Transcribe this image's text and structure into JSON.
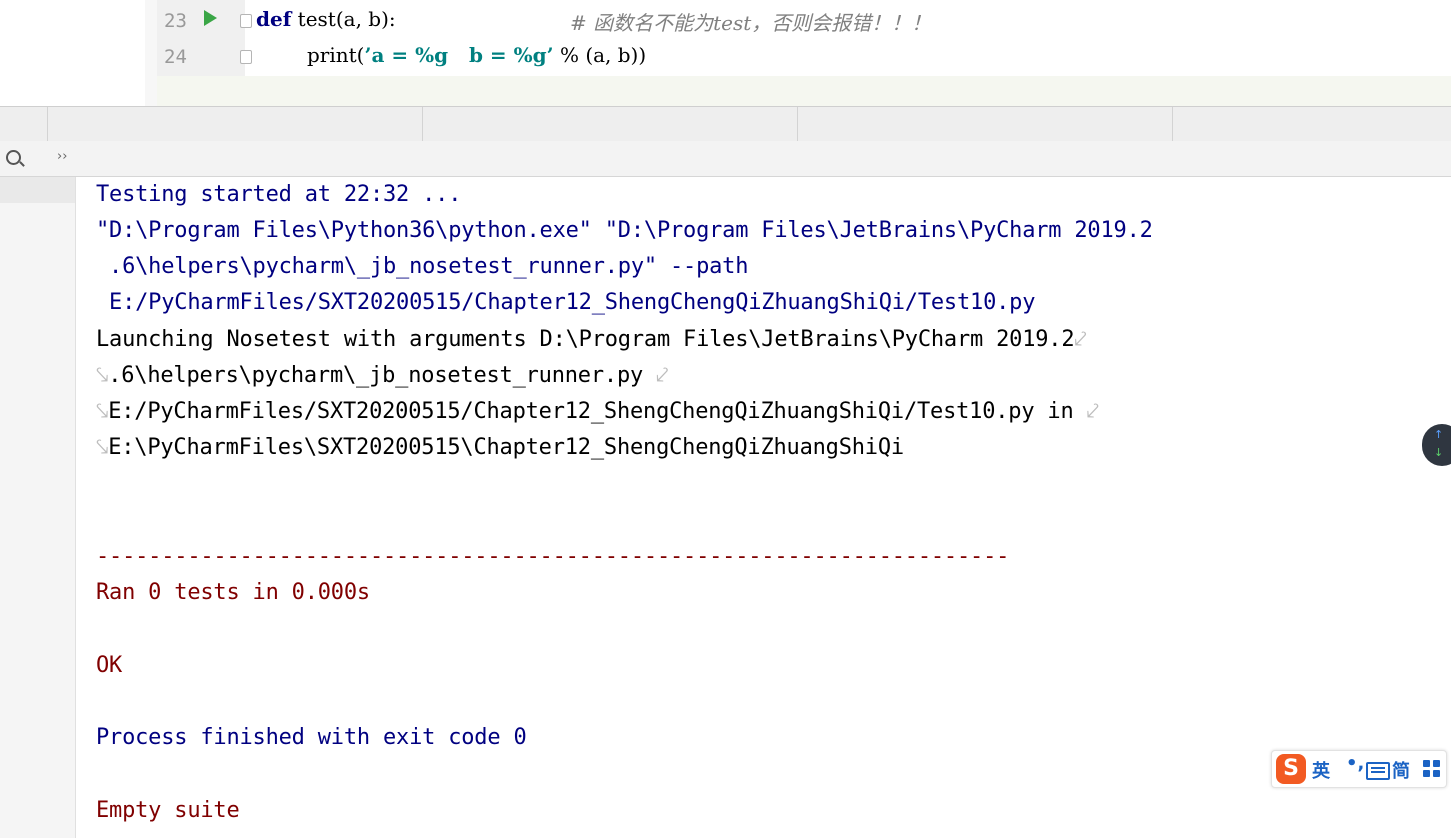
{
  "editor": {
    "line_numbers": [
      "23",
      "24"
    ],
    "line23": {
      "keyword": "def",
      "rest": " test(a, b):",
      "comment": "# 函数名不能为test，否则会报错！！！"
    },
    "line24": {
      "func": "print(",
      "string": "’a = %g   b = %g’",
      "rest": " % (a, b))"
    }
  },
  "toolbar": {
    "more_label": "››"
  },
  "console": {
    "lines": [
      "Testing started at 22:32 ...",
      "\"D:\\Program Files\\Python36\\python.exe\" \"D:\\Program Files\\JetBrains\\PyCharm 2019.2",
      " .6\\helpers\\pycharm\\_jb_nosetest_runner.py\" --path",
      " E:/PyCharmFiles/SXT20200515/Chapter12_ShengChengQiZhuangShiQi/Test10.py",
      "Launching Nosetest with arguments D:\\Program Files\\JetBrains\\PyCharm 2019.2",
      ".6\\helpers\\pycharm\\_jb_nosetest_runner.py ",
      "E:/PyCharmFiles/SXT20200515/Chapter12_ShengChengQiZhuangShiQi/Test10.py in ",
      "E:\\PyCharmFiles\\SXT20200515\\Chapter12_ShengChengQiZhuangShiQi",
      "----------------------------------------------------------------------",
      "Ran 0 tests in 0.000s",
      "OK",
      "Process finished with exit code 0",
      "Empty suite"
    ],
    "wrap_glyph_end": "⤦",
    "wrap_glyph_start": "⤥"
  },
  "ime": {
    "logo": "S",
    "lang": "英",
    "punct": "•,",
    "mode": "简"
  },
  "nav": {
    "up": "↑",
    "down": "↓"
  },
  "colors": {
    "console_blue": "#000080",
    "console_red": "#800000",
    "run_green": "#3aa646",
    "ime_orange": "#f25a22"
  }
}
